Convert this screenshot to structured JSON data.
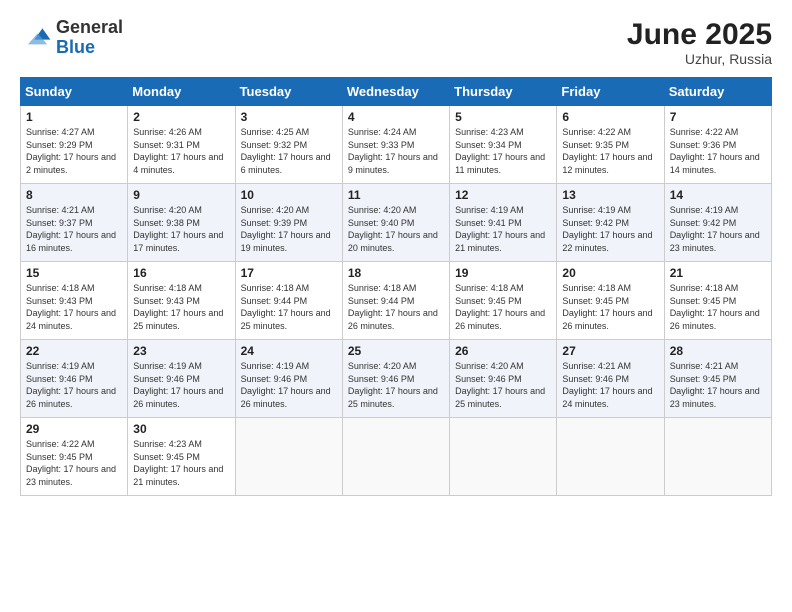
{
  "logo": {
    "general": "General",
    "blue": "Blue"
  },
  "header": {
    "month": "June 2025",
    "location": "Uzhur, Russia"
  },
  "days_of_week": [
    "Sunday",
    "Monday",
    "Tuesday",
    "Wednesday",
    "Thursday",
    "Friday",
    "Saturday"
  ],
  "weeks": [
    [
      {
        "day": "1",
        "sunrise": "4:27 AM",
        "sunset": "9:29 PM",
        "daylight": "17 hours and 2 minutes."
      },
      {
        "day": "2",
        "sunrise": "4:26 AM",
        "sunset": "9:31 PM",
        "daylight": "17 hours and 4 minutes."
      },
      {
        "day": "3",
        "sunrise": "4:25 AM",
        "sunset": "9:32 PM",
        "daylight": "17 hours and 6 minutes."
      },
      {
        "day": "4",
        "sunrise": "4:24 AM",
        "sunset": "9:33 PM",
        "daylight": "17 hours and 9 minutes."
      },
      {
        "day": "5",
        "sunrise": "4:23 AM",
        "sunset": "9:34 PM",
        "daylight": "17 hours and 11 minutes."
      },
      {
        "day": "6",
        "sunrise": "4:22 AM",
        "sunset": "9:35 PM",
        "daylight": "17 hours and 12 minutes."
      },
      {
        "day": "7",
        "sunrise": "4:22 AM",
        "sunset": "9:36 PM",
        "daylight": "17 hours and 14 minutes."
      }
    ],
    [
      {
        "day": "8",
        "sunrise": "4:21 AM",
        "sunset": "9:37 PM",
        "daylight": "17 hours and 16 minutes."
      },
      {
        "day": "9",
        "sunrise": "4:20 AM",
        "sunset": "9:38 PM",
        "daylight": "17 hours and 17 minutes."
      },
      {
        "day": "10",
        "sunrise": "4:20 AM",
        "sunset": "9:39 PM",
        "daylight": "17 hours and 19 minutes."
      },
      {
        "day": "11",
        "sunrise": "4:20 AM",
        "sunset": "9:40 PM",
        "daylight": "17 hours and 20 minutes."
      },
      {
        "day": "12",
        "sunrise": "4:19 AM",
        "sunset": "9:41 PM",
        "daylight": "17 hours and 21 minutes."
      },
      {
        "day": "13",
        "sunrise": "4:19 AM",
        "sunset": "9:42 PM",
        "daylight": "17 hours and 22 minutes."
      },
      {
        "day": "14",
        "sunrise": "4:19 AM",
        "sunset": "9:42 PM",
        "daylight": "17 hours and 23 minutes."
      }
    ],
    [
      {
        "day": "15",
        "sunrise": "4:18 AM",
        "sunset": "9:43 PM",
        "daylight": "17 hours and 24 minutes."
      },
      {
        "day": "16",
        "sunrise": "4:18 AM",
        "sunset": "9:43 PM",
        "daylight": "17 hours and 25 minutes."
      },
      {
        "day": "17",
        "sunrise": "4:18 AM",
        "sunset": "9:44 PM",
        "daylight": "17 hours and 25 minutes."
      },
      {
        "day": "18",
        "sunrise": "4:18 AM",
        "sunset": "9:44 PM",
        "daylight": "17 hours and 26 minutes."
      },
      {
        "day": "19",
        "sunrise": "4:18 AM",
        "sunset": "9:45 PM",
        "daylight": "17 hours and 26 minutes."
      },
      {
        "day": "20",
        "sunrise": "4:18 AM",
        "sunset": "9:45 PM",
        "daylight": "17 hours and 26 minutes."
      },
      {
        "day": "21",
        "sunrise": "4:18 AM",
        "sunset": "9:45 PM",
        "daylight": "17 hours and 26 minutes."
      }
    ],
    [
      {
        "day": "22",
        "sunrise": "4:19 AM",
        "sunset": "9:46 PM",
        "daylight": "17 hours and 26 minutes."
      },
      {
        "day": "23",
        "sunrise": "4:19 AM",
        "sunset": "9:46 PM",
        "daylight": "17 hours and 26 minutes."
      },
      {
        "day": "24",
        "sunrise": "4:19 AM",
        "sunset": "9:46 PM",
        "daylight": "17 hours and 26 minutes."
      },
      {
        "day": "25",
        "sunrise": "4:20 AM",
        "sunset": "9:46 PM",
        "daylight": "17 hours and 25 minutes."
      },
      {
        "day": "26",
        "sunrise": "4:20 AM",
        "sunset": "9:46 PM",
        "daylight": "17 hours and 25 minutes."
      },
      {
        "day": "27",
        "sunrise": "4:21 AM",
        "sunset": "9:46 PM",
        "daylight": "17 hours and 24 minutes."
      },
      {
        "day": "28",
        "sunrise": "4:21 AM",
        "sunset": "9:45 PM",
        "daylight": "17 hours and 23 minutes."
      }
    ],
    [
      {
        "day": "29",
        "sunrise": "4:22 AM",
        "sunset": "9:45 PM",
        "daylight": "17 hours and 23 minutes."
      },
      {
        "day": "30",
        "sunrise": "4:23 AM",
        "sunset": "9:45 PM",
        "daylight": "17 hours and 21 minutes."
      },
      null,
      null,
      null,
      null,
      null
    ]
  ]
}
